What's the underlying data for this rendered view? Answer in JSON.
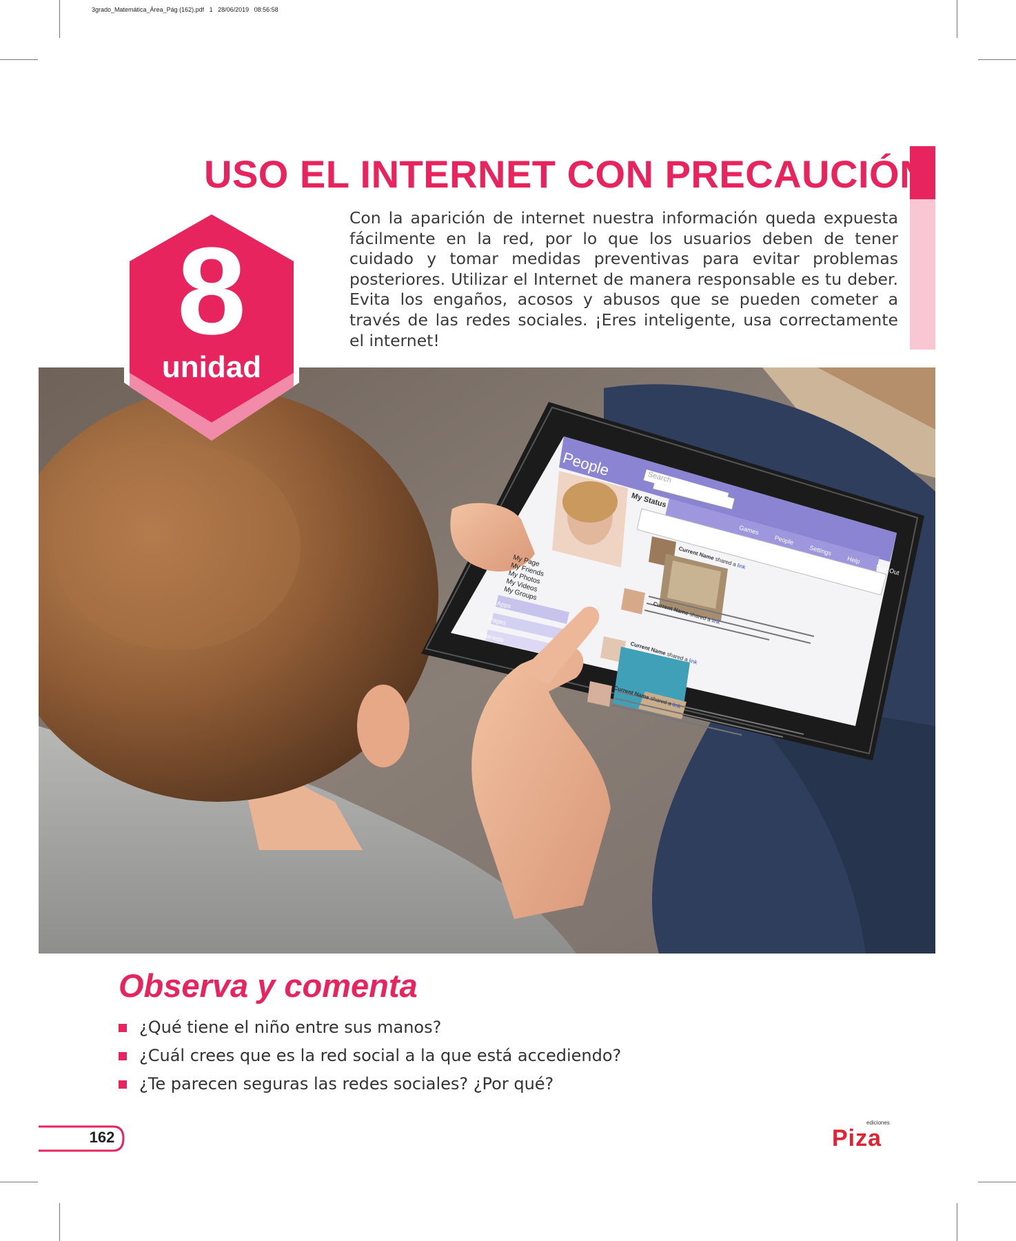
{
  "print_slug": "3grado_Matemática_Área_Pág (162).pdf   1   28/06/2019   08:56:58",
  "unit": {
    "number": "8",
    "label": "unidad"
  },
  "title": "USO EL INTERNET CON PRECAUCIÓN",
  "intro": "Con la aparición de internet nuestra información queda expuesta fácilmente en la red, por lo que los usuarios deben de tener cuidado y tomar medidas preventivas para evitar problemas posteriores. Utilizar el Internet de manera responsable es tu deber. Evita los engaños, acosos y abusos que se pueden cometer a través de las redes sociales. ¡Eres inteligente, usa correctamente el internet!",
  "tablet": {
    "app_name": "People",
    "search_placeholder": "Search",
    "status_label": "My Status",
    "nav": [
      "Games",
      "People",
      "Settings",
      "Help",
      "Sign Out"
    ],
    "menu": [
      "My Page",
      "My Friends",
      "My Photos",
      "My Videos",
      "My Groups"
    ],
    "menu_bars": [
      "Apps",
      "Pages",
      "Interests"
    ],
    "post_author": "Current Name",
    "post_action": "shared a",
    "post_link": "link"
  },
  "section": {
    "title": "Observa y comenta",
    "questions": [
      "¿Qué tiene el niño entre sus manos?",
      "¿Cuál crees que es la red social a la que está accediendo?",
      "¿Te parecen seguras las redes sociales? ¿Por qué?"
    ]
  },
  "page_number": "162",
  "publisher": {
    "small": "ediciones",
    "name": "Piza"
  },
  "colors": {
    "accent": "#e8245f",
    "accent_light": "#f9c6d3",
    "tablet_header": "#8b84d3"
  }
}
